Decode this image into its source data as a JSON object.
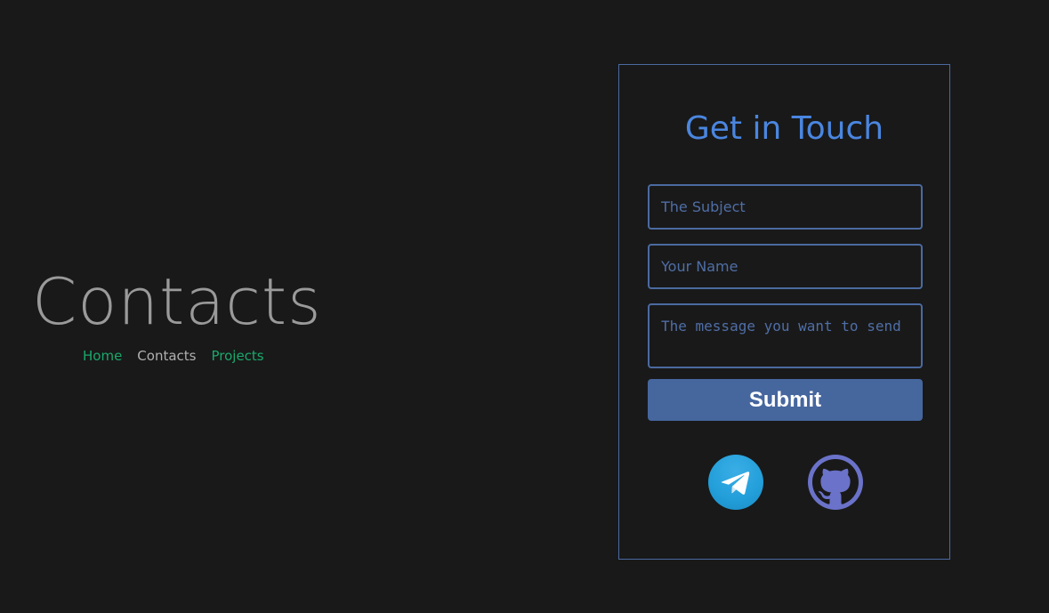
{
  "hero": {
    "title": "Contacts",
    "nav": [
      {
        "label": "Home",
        "color": "#1aa86b"
      },
      {
        "label": "Contacts",
        "color": "#b0b0b0"
      },
      {
        "label": "Projects",
        "color": "#1aa86b"
      }
    ]
  },
  "form": {
    "title": "Get in Touch",
    "subject_placeholder": "The Subject",
    "name_placeholder": "Your Name",
    "message_placeholder": "The message you want to send",
    "submit_label": "Submit"
  },
  "socials": [
    {
      "icon": "telegram-icon",
      "color": "#229ed9"
    },
    {
      "icon": "github-icon",
      "color": "#6a72c9"
    }
  ],
  "colors": {
    "background": "#191919",
    "accent": "#4a86e0",
    "border": "#4b6aa0",
    "button": "#46669e"
  }
}
